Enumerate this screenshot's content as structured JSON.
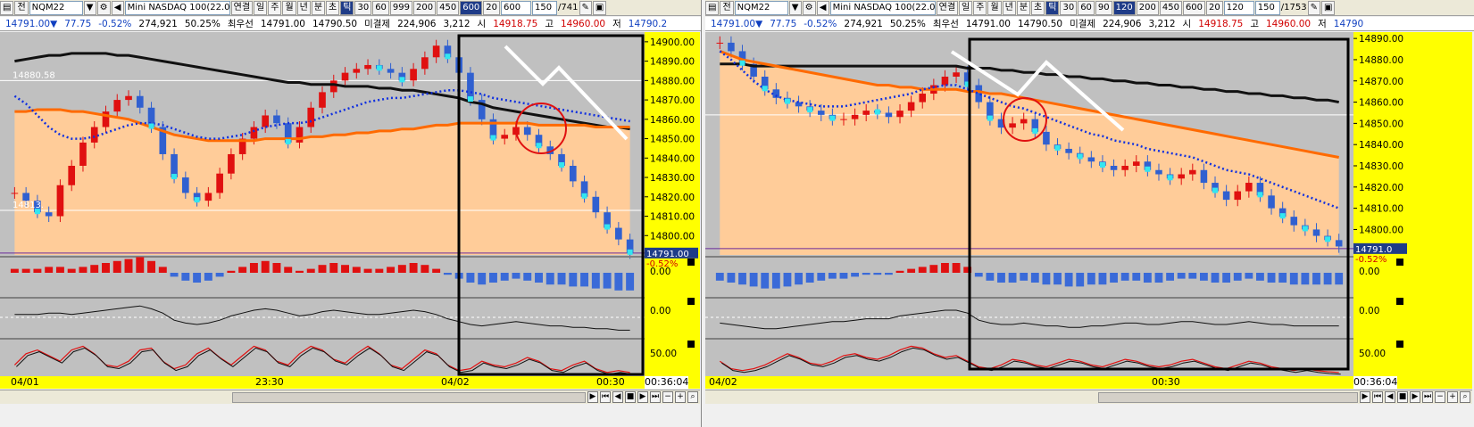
{
  "panes": [
    {
      "toolbar": {
        "jeon": "전",
        "symbol": "NQM22",
        "title": "Mini NASDAQ 100(22.0",
        "menu": [
          "연결",
          "일",
          "주",
          "월",
          "년",
          "분",
          "초",
          "틱"
        ],
        "selected": "틱",
        "periods": [
          "30",
          "60",
          "999",
          "200",
          "450",
          "600",
          "20"
        ],
        "selected_period": "600",
        "period_value": "600",
        "count": "150",
        "total": "/741"
      },
      "quote": {
        "price": "14791.00▼",
        "change": "77.75",
        "pct": "-0.52%",
        "volume": "274,921",
        "vol_pct": "50.25%",
        "best_label": "최우선",
        "bid": "14791.00",
        "ask": "14790.50",
        "unsettled_label": "미결제",
        "unsettled": "224,906",
        "unsettled_chg": "3,212",
        "open_label": "시",
        "open": "14918.75",
        "high_label": "고",
        "high": "14960.00",
        "low_label": "저",
        "low": "14790.2"
      },
      "price_ticks": [
        "14900.00",
        "14890.00",
        "14880.00",
        "14870.00",
        "14860.00",
        "14850.00",
        "14840.00",
        "14830.00",
        "14820.00",
        "14810.00",
        "14800.00"
      ],
      "last_price": "14791.00",
      "last_pct": "-0.52%",
      "ref_label_1": "14880.58",
      "ref_label_2": "14813.",
      "osc_ticks": [
        "0.00",
        "0.00",
        "50.00"
      ],
      "time_labels": [
        "04/01",
        "23:30",
        "04/02",
        "00:30"
      ],
      "time_now": "00:36:04"
    },
    {
      "toolbar": {
        "jeon": "전",
        "symbol": "NQM22",
        "title": "Mini NASDAQ 100(22.0",
        "menu": [
          "연결",
          "일",
          "주",
          "월",
          "년",
          "분",
          "초",
          "틱"
        ],
        "selected": "틱",
        "periods": [
          "30",
          "60",
          "90",
          "120",
          "200",
          "450",
          "600",
          "20"
        ],
        "selected_period": "120",
        "period_value": "120",
        "count": "150",
        "total": "/1753"
      },
      "quote": {
        "price": "14791.00▼",
        "change": "77.75",
        "pct": "-0.52%",
        "volume": "274,921",
        "vol_pct": "50.25%",
        "best_label": "최우선",
        "bid": "14791.00",
        "ask": "14790.50",
        "unsettled_label": "미결제",
        "unsettled": "224,906",
        "unsettled_chg": "3,212",
        "open_label": "시",
        "open": "14918.75",
        "high_label": "고",
        "high": "14960.00",
        "low_label": "저",
        "low": "14790"
      },
      "price_ticks": [
        "14890.00",
        "14880.00",
        "14870.00",
        "14860.00",
        "14850.00",
        "14840.00",
        "14830.00",
        "14820.00",
        "14810.00",
        "14800.00"
      ],
      "last_price": "14791.0",
      "last_pct": "-0.52%",
      "osc_ticks": [
        "0.00",
        "0.00",
        "50.00"
      ],
      "time_labels": [
        "04/02",
        "00:30"
      ],
      "time_now": "00:36:04"
    }
  ],
  "chart_data": [
    {
      "type": "candlestick",
      "title": "Mini NASDAQ 100 600틱",
      "ylim": [
        14790,
        14905
      ],
      "close": [
        14822,
        14818,
        14812,
        14810,
        14826,
        14836,
        14848,
        14856,
        14864,
        14870,
        14872,
        14866,
        14856,
        14842,
        14830,
        14822,
        14818,
        14822,
        14832,
        14842,
        14850,
        14856,
        14862,
        14858,
        14848,
        14856,
        14866,
        14874,
        14880,
        14884,
        14886,
        14888,
        14886,
        14884,
        14880,
        14886,
        14892,
        14898,
        14892,
        14884,
        14870,
        14860,
        14850,
        14852,
        14856,
        14852,
        14846,
        14842,
        14836,
        14828,
        14820,
        14812,
        14804,
        14798,
        14791
      ],
      "ma_long": [
        14890,
        14891,
        14892,
        14893,
        14893,
        14894,
        14894,
        14894,
        14894,
        14893,
        14893,
        14892,
        14891,
        14890,
        14889,
        14888,
        14887,
        14886,
        14885,
        14884,
        14883,
        14882,
        14881,
        14880,
        14879,
        14879,
        14878,
        14878,
        14878,
        14877,
        14877,
        14877,
        14876,
        14876,
        14875,
        14875,
        14874,
        14873,
        14872,
        14871,
        14869,
        14868,
        14866,
        14865,
        14864,
        14863,
        14862,
        14861,
        14860,
        14859,
        14858,
        14857,
        14856,
        14856,
        14855
      ],
      "ma_mid": [
        14864,
        14864,
        14865,
        14865,
        14865,
        14864,
        14864,
        14863,
        14862,
        14861,
        14860,
        14858,
        14856,
        14854,
        14852,
        14851,
        14850,
        14849,
        14849,
        14849,
        14849,
        14849,
        14850,
        14850,
        14850,
        14850,
        14851,
        14851,
        14852,
        14852,
        14853,
        14853,
        14854,
        14854,
        14855,
        14855,
        14856,
        14857,
        14857,
        14858,
        14858,
        14858,
        14858,
        14858,
        14858,
        14858,
        14857,
        14857,
        14857,
        14857,
        14857,
        14856,
        14856,
        14856,
        14856
      ],
      "ma_blue": [
        14872,
        14868,
        14862,
        14856,
        14852,
        14850,
        14850,
        14851,
        14853,
        14855,
        14857,
        14858,
        14858,
        14857,
        14855,
        14853,
        14851,
        14850,
        14850,
        14851,
        14852,
        14854,
        14856,
        14857,
        14858,
        14858,
        14859,
        14861,
        14863,
        14865,
        14867,
        14869,
        14870,
        14871,
        14871,
        14872,
        14873,
        14874,
        14875,
        14875,
        14874,
        14873,
        14871,
        14870,
        14869,
        14868,
        14867,
        14866,
        14865,
        14864,
        14863,
        14862,
        14861,
        14860,
        14859
      ],
      "hist": [
        2,
        2,
        2,
        3,
        3,
        2,
        3,
        4,
        5,
        6,
        7,
        8,
        6,
        3,
        -2,
        -4,
        -5,
        -4,
        -2,
        1,
        3,
        5,
        6,
        5,
        3,
        1,
        2,
        4,
        5,
        4,
        3,
        2,
        2,
        3,
        4,
        5,
        4,
        2,
        -1,
        -3,
        -5,
        -6,
        -5,
        -4,
        -3,
        -4,
        -5,
        -6,
        -6,
        -7,
        -7,
        -8,
        -8,
        -9,
        -9
      ],
      "stoch": [
        30,
        60,
        70,
        55,
        40,
        70,
        80,
        60,
        30,
        25,
        40,
        70,
        75,
        40,
        20,
        30,
        60,
        75,
        50,
        30,
        55,
        80,
        70,
        40,
        30,
        60,
        80,
        70,
        45,
        35,
        60,
        80,
        60,
        30,
        20,
        45,
        70,
        60,
        30,
        15,
        20,
        40,
        30,
        25,
        35,
        50,
        40,
        20,
        15,
        30,
        40,
        20,
        10,
        15,
        10
      ],
      "annotations": [
        "rect",
        "circle",
        "zigzag"
      ]
    },
    {
      "type": "candlestick",
      "title": "Mini NASDAQ 100 120틱",
      "ylim": [
        14788,
        14893
      ],
      "close": [
        14888,
        14884,
        14878,
        14872,
        14866,
        14862,
        14860,
        14858,
        14856,
        14854,
        14852,
        14852,
        14854,
        14856,
        14855,
        14853,
        14856,
        14860,
        14864,
        14868,
        14872,
        14874,
        14868,
        14860,
        14852,
        14848,
        14850,
        14852,
        14846,
        14840,
        14838,
        14836,
        14834,
        14832,
        14830,
        14828,
        14830,
        14832,
        14828,
        14826,
        14824,
        14826,
        14828,
        14822,
        14818,
        14814,
        14818,
        14822,
        14816,
        14810,
        14806,
        14802,
        14800,
        14797,
        14795,
        14792
      ],
      "ma_long": [
        14878,
        14878,
        14878,
        14877,
        14877,
        14877,
        14877,
        14877,
        14877,
        14877,
        14877,
        14877,
        14877,
        14877,
        14877,
        14877,
        14877,
        14877,
        14877,
        14877,
        14877,
        14877,
        14876,
        14876,
        14876,
        14875,
        14875,
        14874,
        14874,
        14873,
        14873,
        14872,
        14872,
        14871,
        14871,
        14870,
        14870,
        14869,
        14869,
        14868,
        14868,
        14867,
        14867,
        14866,
        14866,
        14865,
        14865,
        14864,
        14864,
        14863,
        14863,
        14862,
        14862,
        14861,
        14861,
        14860
      ],
      "ma_mid": [
        14884,
        14882,
        14880,
        14879,
        14878,
        14877,
        14876,
        14875,
        14874,
        14873,
        14872,
        14871,
        14870,
        14869,
        14868,
        14868,
        14867,
        14867,
        14866,
        14866,
        14866,
        14866,
        14865,
        14865,
        14864,
        14864,
        14863,
        14862,
        14861,
        14860,
        14859,
        14858,
        14857,
        14856,
        14855,
        14854,
        14853,
        14852,
        14851,
        14850,
        14849,
        14848,
        14847,
        14846,
        14845,
        14844,
        14843,
        14842,
        14841,
        14840,
        14839,
        14838,
        14837,
        14836,
        14835,
        14834
      ],
      "ma_blue": [
        14884,
        14880,
        14875,
        14870,
        14866,
        14863,
        14861,
        14860,
        14859,
        14858,
        14858,
        14858,
        14859,
        14860,
        14861,
        14862,
        14863,
        14864,
        14866,
        14867,
        14868,
        14868,
        14866,
        14864,
        14862,
        14860,
        14858,
        14857,
        14855,
        14853,
        14851,
        14849,
        14847,
        14845,
        14844,
        14842,
        14841,
        14840,
        14838,
        14837,
        14836,
        14835,
        14834,
        14832,
        14830,
        14828,
        14827,
        14826,
        14824,
        14822,
        14820,
        14818,
        14816,
        14814,
        14812,
        14810
      ],
      "hist": [
        -4,
        -5,
        -6,
        -7,
        -8,
        -8,
        -7,
        -6,
        -5,
        -4,
        -3,
        -3,
        -2,
        -1,
        -1,
        -1,
        1,
        2,
        3,
        4,
        5,
        5,
        3,
        -2,
        -4,
        -5,
        -5,
        -4,
        -5,
        -6,
        -6,
        -7,
        -7,
        -6,
        -6,
        -5,
        -4,
        -4,
        -5,
        -5,
        -4,
        -3,
        -3,
        -4,
        -5,
        -5,
        -4,
        -3,
        -4,
        -5,
        -5,
        -6,
        -6,
        -6,
        -6,
        -6
      ],
      "stoch": [
        40,
        20,
        15,
        20,
        30,
        45,
        60,
        50,
        35,
        30,
        40,
        55,
        60,
        50,
        45,
        55,
        70,
        80,
        75,
        60,
        50,
        55,
        40,
        25,
        20,
        30,
        45,
        40,
        30,
        25,
        35,
        45,
        40,
        30,
        25,
        35,
        45,
        40,
        30,
        25,
        30,
        40,
        45,
        35,
        25,
        20,
        30,
        40,
        35,
        25,
        20,
        15,
        20,
        15,
        12,
        10
      ],
      "annotations": [
        "rect",
        "circle",
        "zigzag"
      ]
    }
  ]
}
